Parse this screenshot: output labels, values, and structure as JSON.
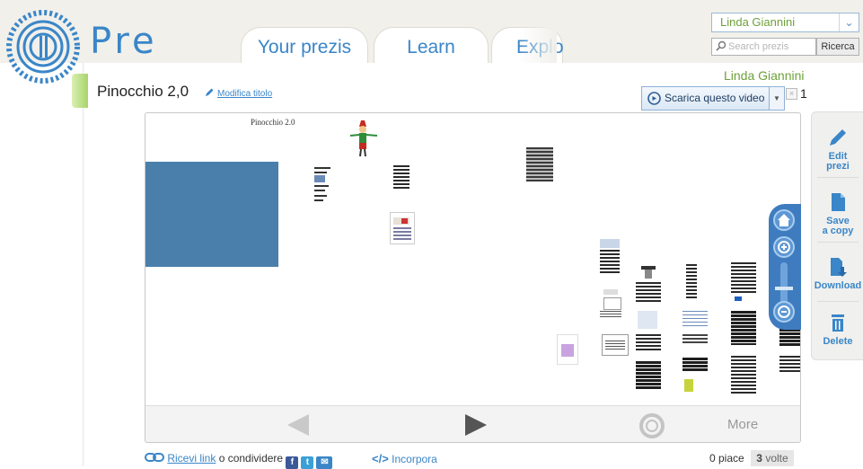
{
  "brand": {
    "logo_text": "Pre"
  },
  "nav": {
    "tabs": [
      {
        "label": "Your prezis"
      },
      {
        "label": "Learn"
      },
      {
        "label": "Explo"
      }
    ]
  },
  "account": {
    "user_name": "Linda Giannini",
    "search_placeholder": "Search prezis",
    "search_button": "Ricerca"
  },
  "presentation": {
    "owner": "Linda Giannini",
    "title": "Pinocchio 2,0",
    "edit_title_link": "Modifica titolo",
    "canvas_heading": "Pinocchio 2.0",
    "download_video_label": "Scarica questo video",
    "download_video_count": "1"
  },
  "viewer": {
    "more_label": "More"
  },
  "side_toolbar": {
    "edit": [
      "Edit",
      "prezi"
    ],
    "save": [
      "Save",
      "a copy"
    ],
    "download": [
      "Download"
    ],
    "delete": [
      "Delete"
    ]
  },
  "share": {
    "link_label": "Ricevi link",
    "or_share": "o condividere",
    "embed_label": "Incorpora"
  },
  "likes": {
    "label": "0 piace",
    "count": "3",
    "times": "volte"
  },
  "colors": {
    "accent_blue": "#3a86c8",
    "user_green": "#6da13a",
    "canvas_block": "#4a7fab",
    "zoom_blue": "#3f7cbf"
  },
  "icons": [
    "prezi-logo-icon",
    "search-icon",
    "pencil-icon",
    "video-icon",
    "home-icon",
    "zoom-in-icon",
    "zoom-out-icon",
    "edit-icon",
    "save-icon",
    "download-icon",
    "delete-icon",
    "link-icon",
    "facebook-icon",
    "twitter-icon",
    "email-icon",
    "embed-icon",
    "prev-arrow-icon",
    "next-arrow-icon",
    "fullscreen-icon"
  ]
}
